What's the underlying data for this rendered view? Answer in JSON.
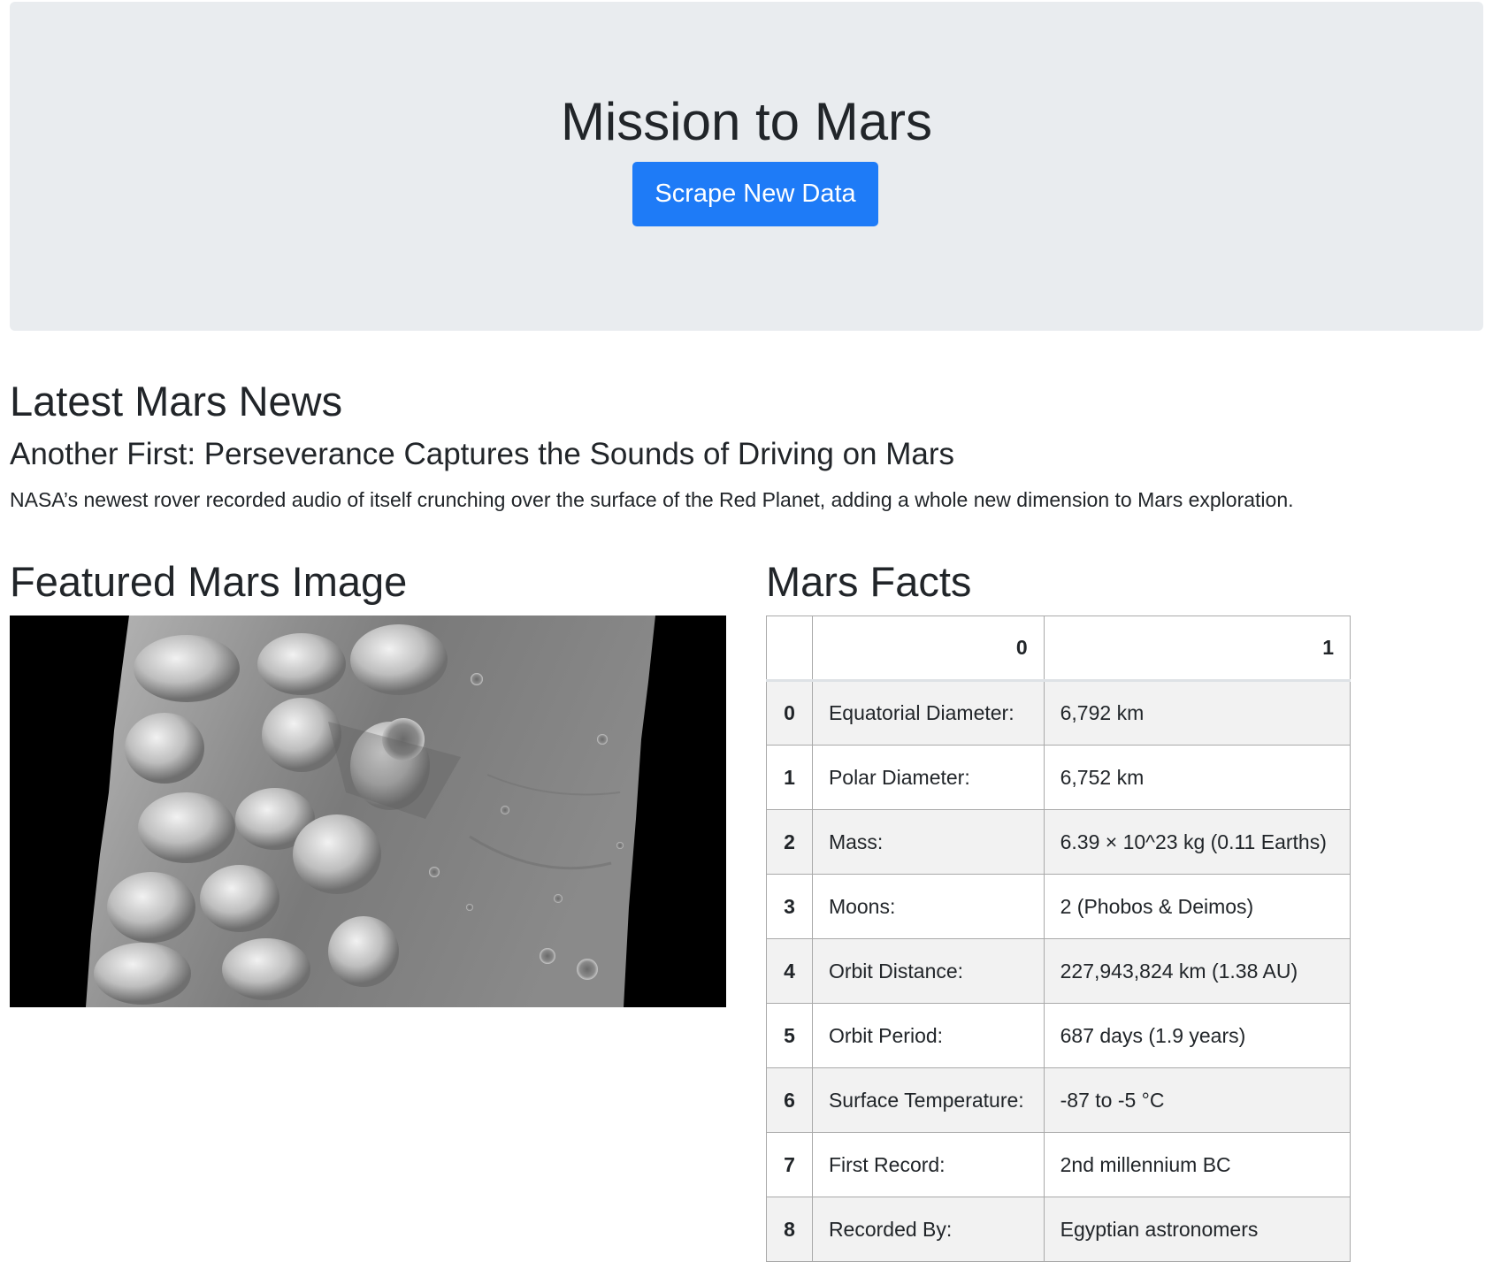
{
  "header": {
    "title": "Mission to Mars",
    "scrape_button": "Scrape New Data",
    "button_color": "#1e7bf7"
  },
  "news": {
    "heading": "Latest Mars News",
    "title": "Another First: Perseverance Captures the Sounds of Driving on Mars",
    "teaser": "NASA’s newest rover recorded audio of itself crunching over the surface of the Red Planet, adding a whole new dimension to Mars exploration."
  },
  "featured_image": {
    "heading": "Featured Mars Image"
  },
  "facts": {
    "heading": "Mars Facts",
    "columns": [
      "",
      "0",
      "1"
    ],
    "rows": [
      {
        "index": "0",
        "label": "Equatorial Diameter:",
        "value": "6,792 km"
      },
      {
        "index": "1",
        "label": "Polar Diameter:",
        "value": "6,752 km"
      },
      {
        "index": "2",
        "label": "Mass:",
        "value": "6.39 × 10^23 kg (0.11 Earths)"
      },
      {
        "index": "3",
        "label": "Moons:",
        "value": "2 (Phobos & Deimos)"
      },
      {
        "index": "4",
        "label": "Orbit Distance:",
        "value": "227,943,824 km (1.38 AU)"
      },
      {
        "index": "5",
        "label": "Orbit Period:",
        "value": "687 days (1.9 years)"
      },
      {
        "index": "6",
        "label": "Surface Temperature:",
        "value": "-87 to -5 °C"
      },
      {
        "index": "7",
        "label": "First Record:",
        "value": "2nd millennium BC"
      },
      {
        "index": "8",
        "label": "Recorded By:",
        "value": "Egyptian astronomers"
      }
    ]
  }
}
